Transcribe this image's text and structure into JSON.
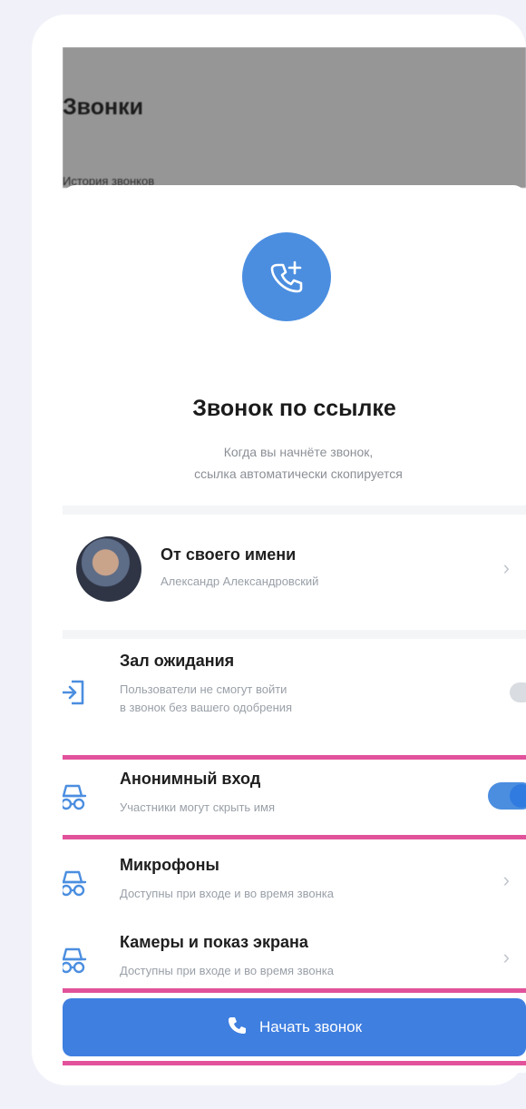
{
  "backdrop": {
    "title": "Звонки",
    "sub": "История звонков"
  },
  "sheet": {
    "title": "Звонок по ссылке",
    "description_line1": "Когда вы начнёте звонок,",
    "description_line2": "ссылка автоматически скопируется"
  },
  "account": {
    "title": "От своего имени",
    "subtitle": "Александр Александровский"
  },
  "settings": [
    {
      "title": "Зал ожидания",
      "subtitle_line1": "Пользователи не смогут войти",
      "subtitle_line2": "в звонок без вашего одобрения",
      "toggle_on": false
    },
    {
      "title": "Анонимный вход",
      "subtitle_line1": "Участники могут скрыть имя",
      "toggle_on": true
    },
    {
      "title": "Микрофоны",
      "subtitle_line1": "Доступны при входе и во время звонка"
    },
    {
      "title": "Камеры и показ экрана",
      "subtitle_line1": "Доступны при входе и во время звонка"
    }
  ],
  "cta": {
    "label": "Начать звонок"
  },
  "colors": {
    "accent": "#4b8ee0",
    "highlight": "#e2529b",
    "cta": "#3f7fe0"
  }
}
